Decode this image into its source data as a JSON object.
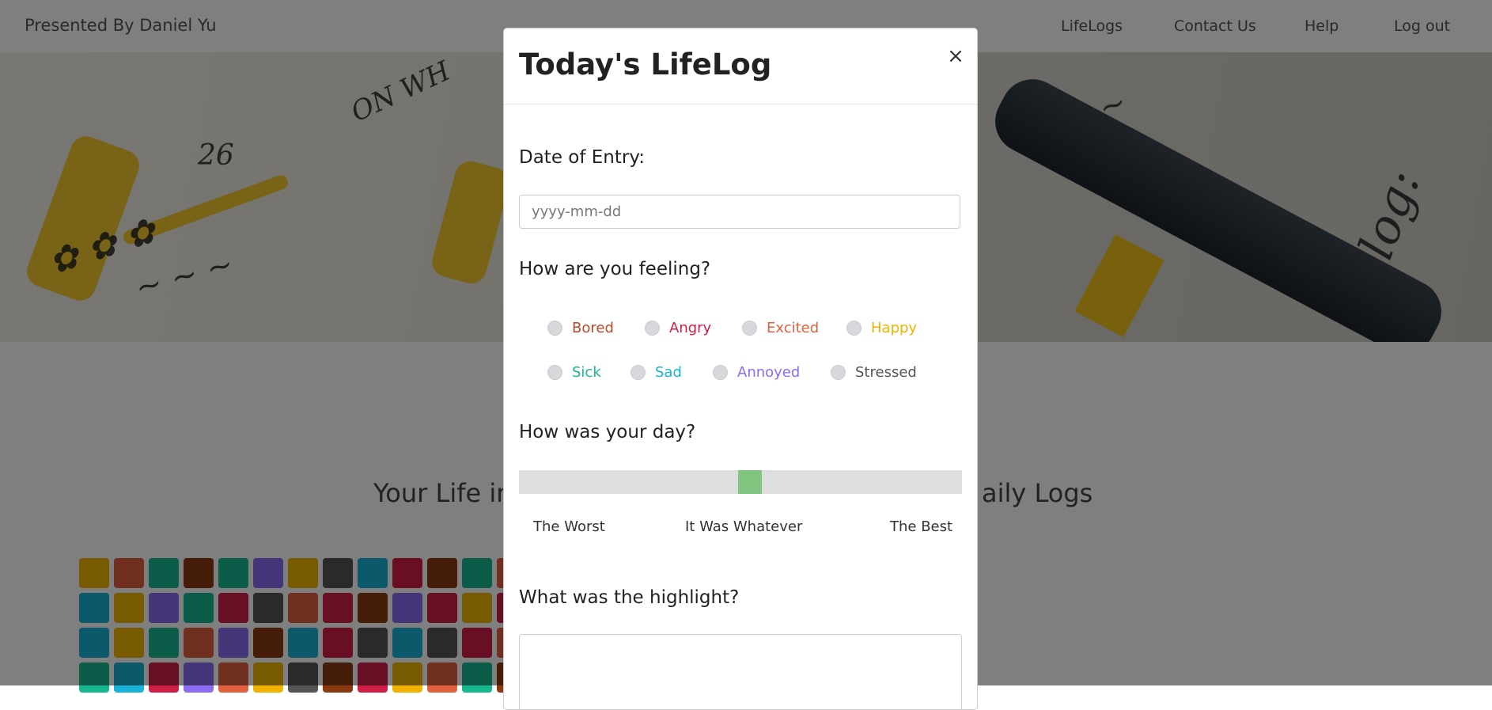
{
  "navbar": {
    "brand": "Presented By Daniel Yu",
    "links": [
      "LifeLogs",
      "Contact Us",
      "Help",
      "Log out"
    ]
  },
  "page": {
    "title_left": "Your Life in",
    "title_right": "aily Logs"
  },
  "modal": {
    "title": "Today's LifeLog",
    "close_icon": "×",
    "date": {
      "label": "Date of Entry:",
      "placeholder": "yyyy-mm-dd",
      "value": ""
    },
    "feeling": {
      "label": "How are you feeling?",
      "options": [
        {
          "label": "Bored",
          "color": "#b44c2a"
        },
        {
          "label": "Angry",
          "color": "#d01f47"
        },
        {
          "label": "Excited",
          "color": "#e2613f"
        },
        {
          "label": "Happy",
          "color": "#f0b400"
        },
        {
          "label": "Sick",
          "color": "#17b890"
        },
        {
          "label": "Sad",
          "color": "#18b3d6"
        },
        {
          "label": "Annoyed",
          "color": "#8b6cf2"
        },
        {
          "label": "Stressed",
          "color": "#555555"
        }
      ]
    },
    "day": {
      "label": "How was your day?",
      "value": 0.5,
      "labels": [
        "The Worst",
        "It Was Whatever",
        "The Best"
      ]
    },
    "highlight": {
      "label": "What was the highlight?",
      "value": ""
    }
  },
  "colors": {
    "mood_tiles": [
      "#f0b400",
      "#e2613f",
      "#17b890",
      "#8b3a10",
      "#8b6cf2",
      "#18b3d6",
      "#d01f47",
      "#555555"
    ]
  }
}
